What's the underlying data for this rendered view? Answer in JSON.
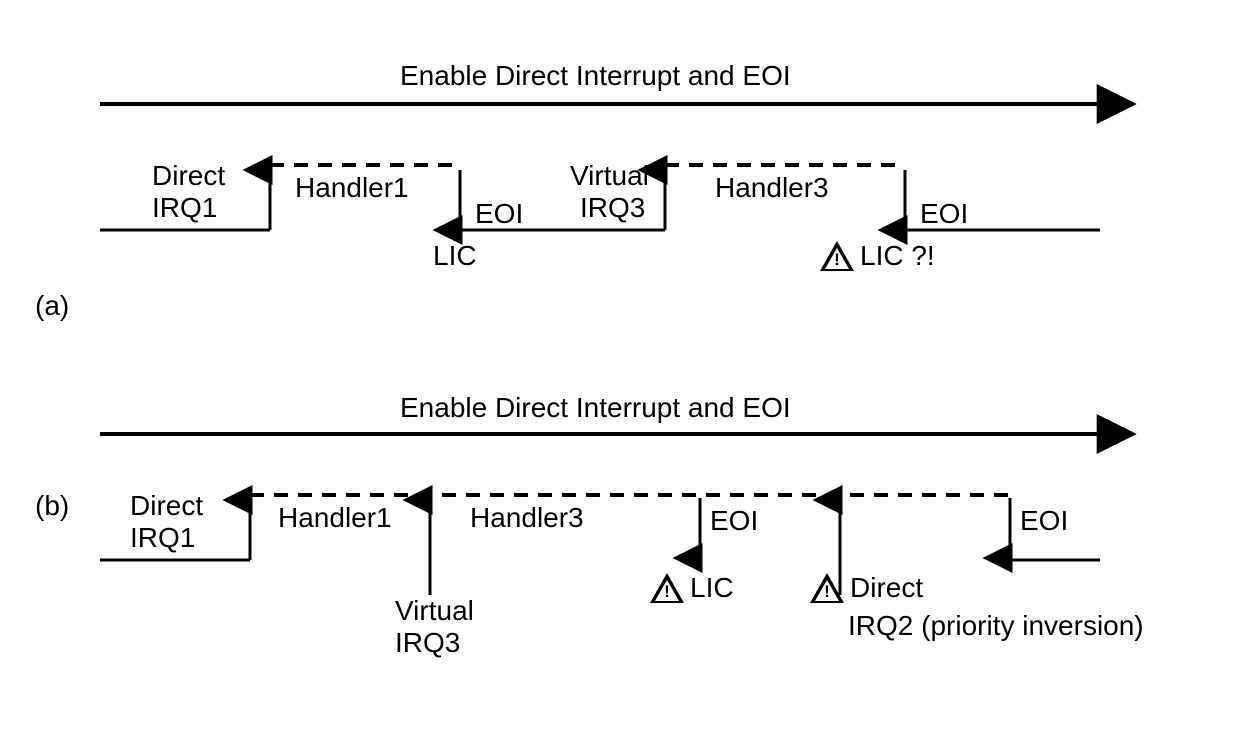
{
  "header_a": "Enable Direct Interrupt and EOI",
  "header_b": "Enable Direct Interrupt and EOI",
  "tag_a": "(a)",
  "tag_b": "(b)",
  "a": {
    "irq1_l1": "Direct",
    "irq1_l2": "IRQ1",
    "handler1": "Handler1",
    "eoi1": "EOI",
    "lic1": "LIC",
    "virq_l1": "Virtual",
    "virq_l2": "IRQ3",
    "handler3": "Handler3",
    "eoi2": "EOI",
    "lic2": "LIC ?!"
  },
  "b": {
    "irq1_l1": "Direct",
    "irq1_l2": "IRQ1",
    "handler1": "Handler1",
    "virq_l1": "Virtual",
    "virq_l2": "IRQ3",
    "handler3": "Handler3",
    "eoi1": "EOI",
    "lic1": "LIC",
    "eoi2": "EOI",
    "dirq2_l1": "Direct",
    "dirq2_l2": "IRQ2 (priority inversion)"
  }
}
